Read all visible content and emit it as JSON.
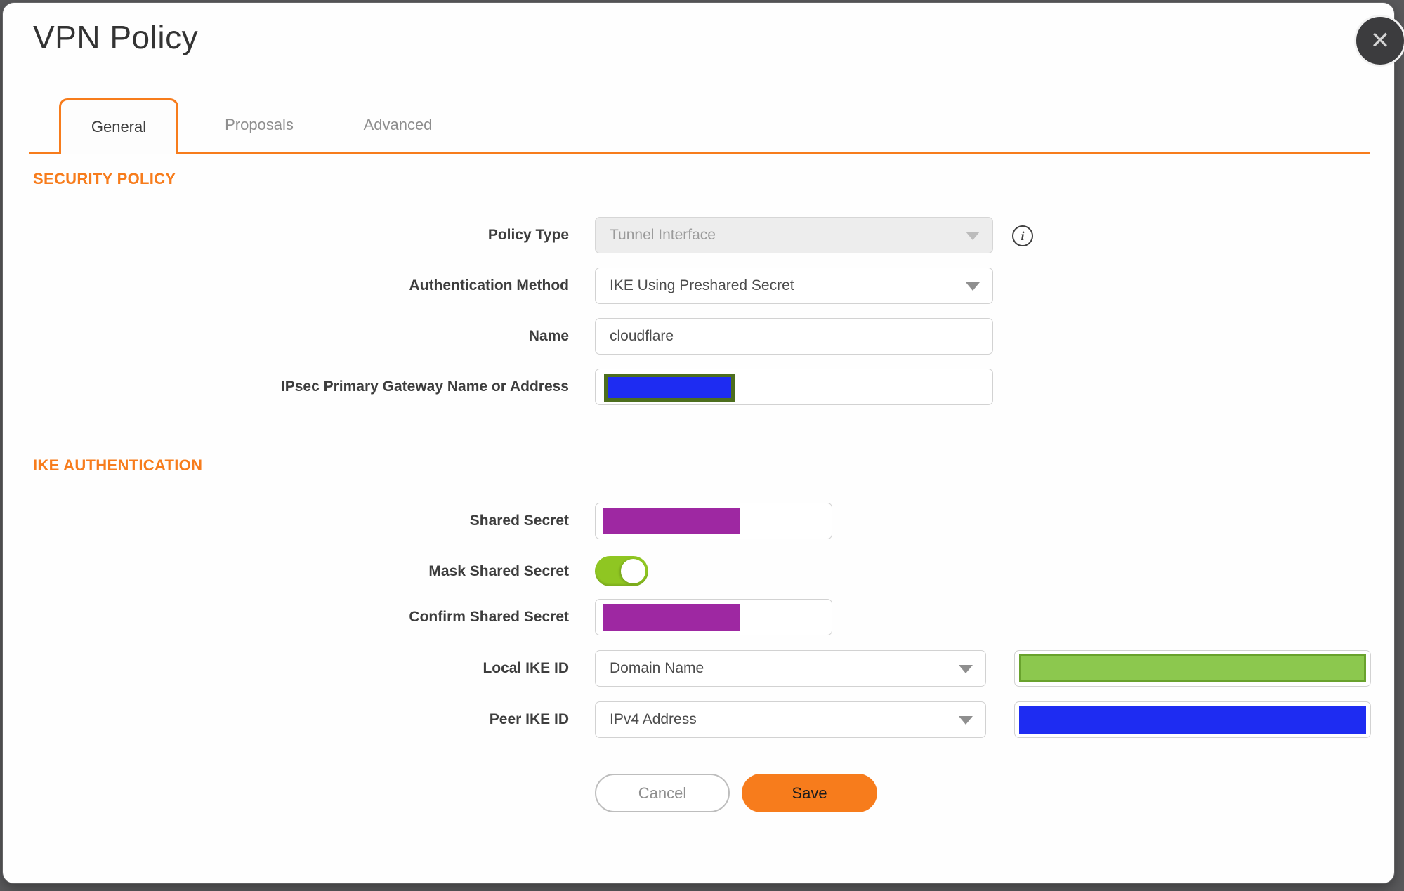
{
  "window": {
    "title": "VPN Policy"
  },
  "tabs": {
    "general": {
      "label": "General",
      "active": true
    },
    "proposals": {
      "label": "Proposals",
      "active": false
    },
    "advanced": {
      "label": "Advanced",
      "active": false
    }
  },
  "sections": {
    "security_policy": "SECURITY POLICY",
    "ike_authentication": "IKE AUTHENTICATION"
  },
  "fields": {
    "policy_type": {
      "label": "Policy Type",
      "value": "Tunnel Interface",
      "disabled": true
    },
    "authentication_method": {
      "label": "Authentication Method",
      "value": "IKE Using Preshared Secret"
    },
    "name": {
      "label": "Name",
      "value": "cloudflare"
    },
    "ipsec_primary_gateway": {
      "label": "IPsec Primary Gateway Name or Address",
      "value_state": "redacted-blue"
    },
    "shared_secret": {
      "label": "Shared Secret",
      "value_state": "redacted-purple"
    },
    "mask_shared_secret": {
      "label": "Mask Shared Secret",
      "state": "on"
    },
    "confirm_shared_secret": {
      "label": "Confirm Shared Secret",
      "value_state": "redacted-purple"
    },
    "local_ike_id": {
      "label": "Local IKE ID",
      "value": "Domain Name",
      "value_state": "redacted-green"
    },
    "peer_ike_id": {
      "label": "Peer IKE ID",
      "value": "IPv4 Address",
      "value_state": "redacted-blue"
    }
  },
  "buttons": {
    "cancel": "Cancel",
    "save": "Save"
  },
  "icons": {
    "close": "✕",
    "info": "i"
  },
  "colors": {
    "accent_orange": "#f77c1c",
    "redaction_purple": "#9e28a2",
    "redaction_blue": "#1e2cf2",
    "redaction_green": "#8cc84e",
    "toggle_green": "#8fc622",
    "backdrop_gray": "#59595b"
  }
}
